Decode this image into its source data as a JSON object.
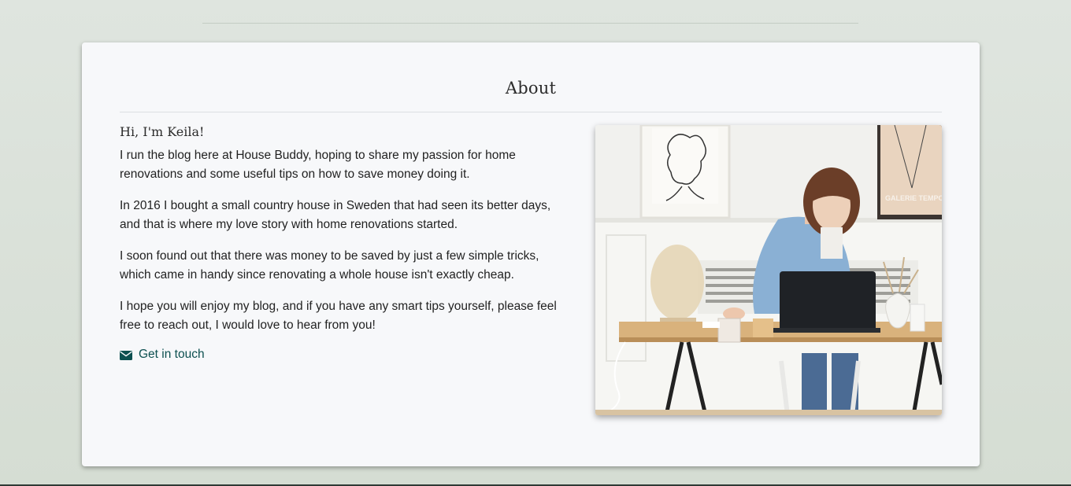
{
  "section": {
    "title": "About"
  },
  "about": {
    "greeting": "Hi, I'm Keila!",
    "paragraphs": [
      "I run the blog here at House Buddy, hoping to share my passion for home renovations and some useful tips on how to save money doing it.",
      "In 2016 I bought a small country house in Sweden that had seen its better days, and that is where my love story with home renovations started.",
      "I soon found out that there was money to be saved by just a few simple tricks, which came in handy since renovating a whole house isn't exactly cheap.",
      "I hope you will enjoy my blog, and if you have any smart tips yourself, please feel free to reach out, I would love to hear from you!"
    ],
    "contact_label": "Get in touch",
    "contact_icon": "envelope-icon",
    "photo_poster_text": "GALERIE TEMPO"
  },
  "colors": {
    "accent": "#0d5050",
    "card_background": "#f7f8fa",
    "page_background": "#dfe5df"
  }
}
